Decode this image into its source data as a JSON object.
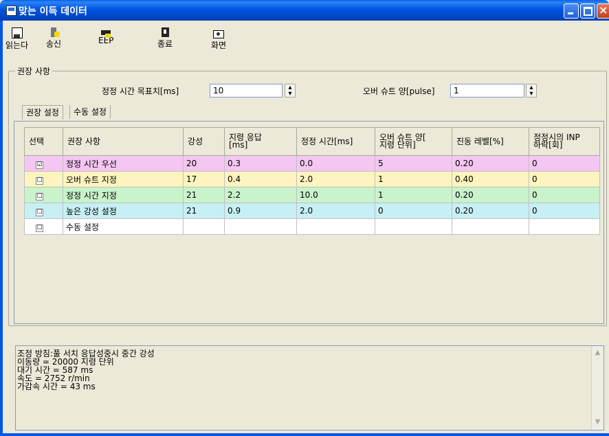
{
  "window": {
    "title": "맞는 이득 데이터",
    "controls": [
      "minimize",
      "maximize",
      "close"
    ]
  },
  "toolbar": {
    "buttons": [
      {
        "label": "읽는다",
        "icon": "floppy-disk-icon"
      },
      {
        "label": "송신",
        "icon": "send-icon"
      },
      {
        "label": "EEP",
        "icon": "eep-write-icon"
      },
      {
        "label": "종료",
        "icon": "exit-door-icon"
      },
      {
        "label": "화면",
        "icon": "camera-icon"
      }
    ]
  },
  "group": {
    "title": "권장 사항",
    "settle_label": "정정 시간 목표치[ms]",
    "settle_value": "10",
    "overshoot_label": "오버 슈트 양[pulse]",
    "overshoot_value": "1"
  },
  "tabs": [
    {
      "label": "권장 설정",
      "active": true
    },
    {
      "label": "수동 설정",
      "active": false
    }
  ],
  "grid": {
    "columns": [
      "선택",
      "권장 사항",
      "강성",
      "지령 응답\n[ms]",
      "정정 시간[ms]",
      "오버 슈트 양[\n지령 단위]",
      "진동 레벨[%]",
      "정정시의 INP\n하락[회]"
    ],
    "rows": [
      {
        "checked": true,
        "mark": "☑",
        "name": "정정 시간 우선",
        "stiffness": "20",
        "response": "0.3",
        "settle": "0.0",
        "overshoot": "5",
        "vibration": "0.20",
        "inp": "0",
        "color": "#f4c6f2"
      },
      {
        "checked": false,
        "mark": "☐",
        "name": "오버 슈트 지정",
        "stiffness": "17",
        "response": "0.4",
        "settle": "2.0",
        "overshoot": "1",
        "vibration": "0.40",
        "inp": "0",
        "color": "#fdf4bf"
      },
      {
        "checked": false,
        "mark": "☐",
        "name": "정정 시간 지정",
        "stiffness": "21",
        "response": "2.2",
        "settle": "10.0",
        "overshoot": "1",
        "vibration": "0.20",
        "inp": "0",
        "color": "#c9f3cb"
      },
      {
        "checked": false,
        "mark": "☐",
        "name": "높은 강성 설정",
        "stiffness": "21",
        "response": "0.9",
        "settle": "2.0",
        "overshoot": "0",
        "vibration": "0.20",
        "inp": "0",
        "color": "#c6f0f4"
      },
      {
        "checked": false,
        "mark": "☐",
        "name": "수동 설정",
        "stiffness": "",
        "response": "",
        "settle": "",
        "overshoot": "",
        "vibration": "",
        "inp": "",
        "color": "#ffffff"
      }
    ]
  },
  "log": {
    "lines": [
      "조정 방침:풀 서치 응답성중시 중간 강성",
      "이동량 = 20000 지령 단위",
      "대기 시간 = 587 ms",
      "속도 = 2752 r/min",
      "가감속 시간 = 43 ms"
    ]
  },
  "colors": {
    "window_bg": "#ece9d8",
    "titlebar": "#0053e1",
    "row_selected": "#f4c6f2",
    "row_overshoot": "#fdf4bf",
    "row_settle": "#c9f3cb",
    "row_stiff": "#c6f0f4"
  }
}
